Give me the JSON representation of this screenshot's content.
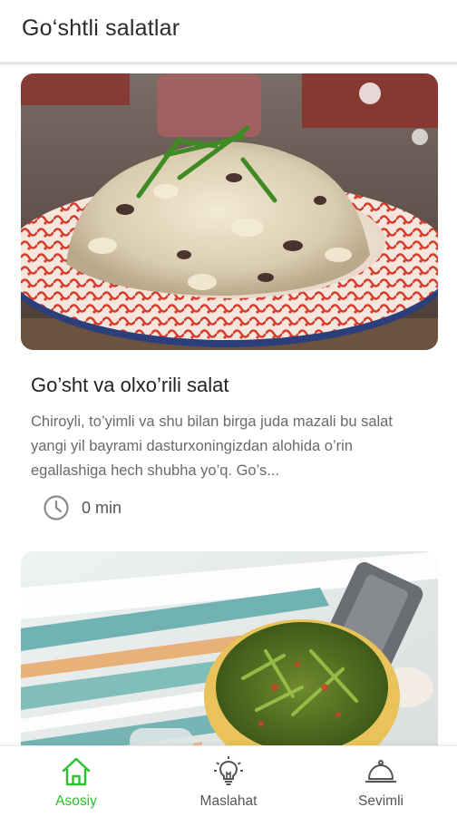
{
  "app": {
    "title": "Go‘shtli salatlar"
  },
  "recipes": [
    {
      "name": "Go’sht va olxo’rili salat",
      "description": "Chiroyli, to’yimli va shu bilan birga juda mazali bu salat yangi yil bayrami dasturxoningizdan alohida o’rin egallashiga hech shubha yo’q. Go’s...",
      "time": "0 min"
    }
  ],
  "nav": {
    "items": [
      {
        "label": "Asosiy",
        "icon": "home-icon",
        "active": true
      },
      {
        "label": "Maslahat",
        "icon": "lightbulb-icon",
        "active": false
      },
      {
        "label": "Sevimli",
        "icon": "cloche-icon",
        "active": false
      }
    ]
  },
  "colors": {
    "accent": "#2dbf2d",
    "text": "#222222",
    "muted": "#6a6a6a"
  }
}
